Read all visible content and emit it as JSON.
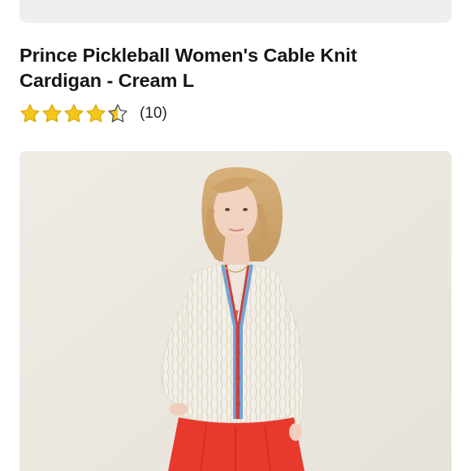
{
  "product": {
    "title": "Prince Pickleball Women's Cable Knit Cardigan - Cream L",
    "rating": {
      "value": 4.5,
      "max": 5,
      "review_count_label": "(10)",
      "star_color": "#f5c518",
      "star_empty_color": "#ffffff",
      "star_outline_color": "#4a4a4a"
    },
    "image": {
      "subject": "model-wearing-cream-cable-knit-cardigan",
      "cardigan_color": "#f3efe6",
      "trim_colors": [
        "#c9403f",
        "#6fa4d6"
      ],
      "skirt_color": "#e8392e",
      "background_color": "#eeeae2"
    }
  }
}
